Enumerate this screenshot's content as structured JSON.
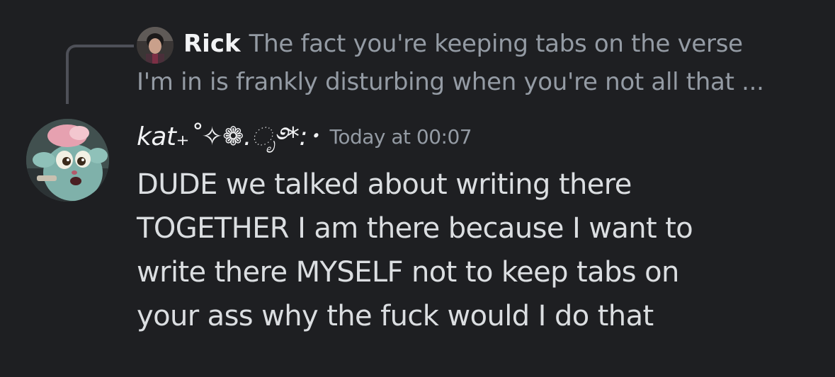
{
  "reply": {
    "author": "Rick",
    "text_line1": "The fact you're keeping tabs on the verse",
    "text_line2": "I'm in is frankly disturbing when you're not all that ..."
  },
  "message": {
    "author": "kat₊˚✧❁.ೃ࿔*:･",
    "timestamp": "Today at 00:07",
    "lines": [
      "DUDE we talked about writing there",
      "TOGETHER I am there because I want to",
      "write there MYSELF not to keep tabs on",
      "your ass why the fuck would I do that"
    ]
  },
  "colors": {
    "background": "#1e1f22",
    "text": "#dbdee1",
    "muted": "#949ba4",
    "username": "#f2f3f5",
    "reply_line": "#4e5058"
  },
  "icons": {
    "reply_avatar": "user-avatar-rick",
    "avatar": "user-avatar-kat"
  }
}
